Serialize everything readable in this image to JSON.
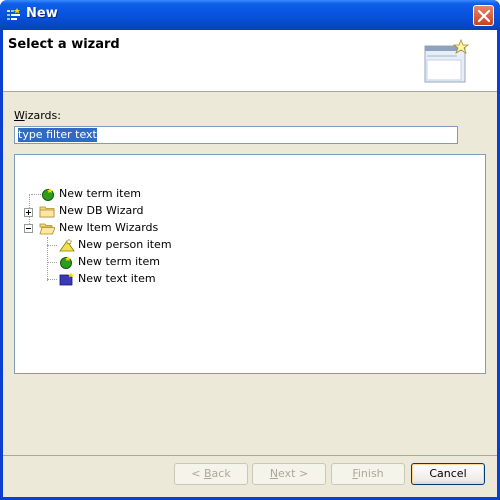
{
  "window": {
    "title": "New",
    "app_icon": "wizard-app-icon",
    "close_icon": "close-icon"
  },
  "header": {
    "title": "Select a wizard",
    "banner_icon": "new-wizard-banner-icon"
  },
  "wizards_label": {
    "mnemonic": "W",
    "rest": "izards:"
  },
  "filter": {
    "value": "type filter text"
  },
  "tree": {
    "items": [
      {
        "label": "New term item",
        "icon": "term-item-icon",
        "level": 0,
        "expander": "none"
      },
      {
        "label": "New DB Wizard",
        "icon": "folder-icon",
        "level": 0,
        "expander": "collapsed"
      },
      {
        "label": "New Item Wizards",
        "icon": "folder-open-icon",
        "level": 0,
        "expander": "expanded"
      },
      {
        "label": "New person item",
        "icon": "person-item-icon",
        "level": 1,
        "expander": "none"
      },
      {
        "label": "New term item",
        "icon": "term-item-icon",
        "level": 1,
        "expander": "none"
      },
      {
        "label": "New text item",
        "icon": "text-item-icon",
        "level": 1,
        "expander": "none"
      }
    ]
  },
  "buttons": {
    "back": {
      "prefix": "< ",
      "mnemonic": "B",
      "rest": "ack",
      "enabled": false
    },
    "next": {
      "mnemonic": "N",
      "rest": "ext >",
      "enabled": false
    },
    "finish": {
      "mnemonic": "F",
      "rest": "inish",
      "enabled": false
    },
    "cancel": {
      "label": "Cancel",
      "enabled": true
    }
  }
}
